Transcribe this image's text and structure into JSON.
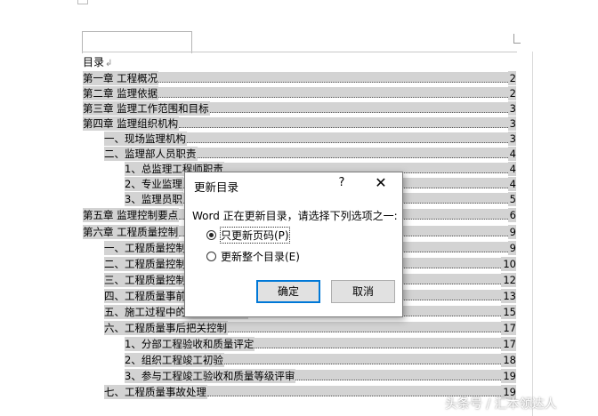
{
  "toc": {
    "title": "目录",
    "rows": [
      {
        "text": "第一章   工程概况",
        "page": "2"
      },
      {
        "text": "第二章   监理依据",
        "page": "2"
      },
      {
        "text": "第三章   监理工作范围和目标",
        "page": "3"
      },
      {
        "text": "第四章     监理组织机构",
        "page": "3"
      },
      {
        "text": "一、现场监理机构",
        "page": "3"
      },
      {
        "text": "二、监理部人员职责",
        "page": "4"
      },
      {
        "text": "1、总监理工程师职责",
        "page": "4"
      },
      {
        "text": "2、专业监理",
        "page": "4"
      },
      {
        "text": "3、监理员职",
        "page": "5"
      },
      {
        "text": "第五章   监理控制要点",
        "page": "6"
      },
      {
        "text": "第六章   工程质量控制",
        "page": "9"
      },
      {
        "text": "一、工程质量控制",
        "page": "9"
      },
      {
        "text": "二、工程质量控制",
        "page": "10"
      },
      {
        "text": "三、工程质量控制",
        "page": "12"
      },
      {
        "text": "四、工程质量事前",
        "page": "13"
      },
      {
        "text": "五、施工过程中的质量控制措施",
        "page": "15"
      },
      {
        "text": "六、工程质量事后把关控制",
        "page": "17"
      },
      {
        "text": "1、分部工程验收和质量评定",
        "page": "17"
      },
      {
        "text": "2、组织工程竣工初验",
        "page": "18"
      },
      {
        "text": "3、参与工程竣工验收和质量等级评审",
        "page": "19"
      },
      {
        "text": "七、工程质量事故处理",
        "page": "19"
      }
    ]
  },
  "dialog": {
    "title": "更新目录",
    "help": "?",
    "close": "✕",
    "message": "Word 正在更新目录，请选择下列选项之一:",
    "option_pages": "只更新页码(P)",
    "option_all": "更新整个目录(E)",
    "ok": "确定",
    "cancel": "取消"
  },
  "watermark": "头条号 / 汇本领达人"
}
